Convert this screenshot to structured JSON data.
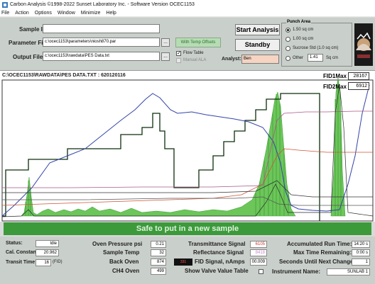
{
  "window": {
    "title": "Carbon Analysis ©1998-2022 Sunset Laboratory Inc. - Software Version OCEC1153"
  },
  "menu": [
    "File",
    "Action",
    "Options",
    "Window",
    "Minimize",
    "Help"
  ],
  "controls": {
    "sample_id_label": "Sample ID",
    "sample_id_value": "",
    "parameter_file_label": "Parameter File",
    "parameter_file_value": "c:\\ocec1153\\parameters\\niosh870.par",
    "output_file_label": "Output File",
    "output_file_value": "c:\\ocec1153\\rawdata\\PES Data.txt",
    "browse_label": "...",
    "with_temp_offsets_label": "With Temp Offsets",
    "flow_table_label": "Flow Table",
    "flow_table_checked": true,
    "manual_ala_label": "Manual ALA",
    "start_analysis_label": "Start Analysis",
    "standby_label": "Standby",
    "analyst_label": "Analyst:",
    "analyst_value": "Ben"
  },
  "punch_area": {
    "title": "Punch Area",
    "options": [
      "1.50 sq cm",
      "1.00 sq cm",
      "Sucrose Std (1.0 sq cm)",
      "Other"
    ],
    "selected_index": 0,
    "other_value": "1.41",
    "other_unit": "Sq cm"
  },
  "chart": {
    "path_label": "C:\\OCEC1153\\RAWDATA\\PES DATA.TXT : 620120116",
    "fid1max_label": "FID1Max",
    "fid1max_value": "28167",
    "fid2max_label": "FID2Max",
    "fid2max_value": "6912",
    "colors": {
      "temperature": "#0c2e0c",
      "fid": "#5fbf4a",
      "laser": "#3344aa",
      "pressure": "#cc5533",
      "oven_temp": "#aa5588"
    }
  },
  "status_message": "Safe to put in a new sample",
  "bottom": {
    "status_label": "Status:",
    "status_value": "Idle",
    "cal_constant_label": "Cal. Constant =",
    "cal_constant_value": "20.962",
    "transit_time_label": "Transit Time =",
    "transit_time_value": "16",
    "transit_time_unit": "(FID)",
    "oven_pressure_label": "Oven Pressure psi",
    "oven_pressure_value": "0.21",
    "sample_temp_label": "Sample Temp",
    "sample_temp_value": "32",
    "back_oven_label": "Back Oven",
    "back_oven_value": "874",
    "ch4_oven_label": "CH4 Oven",
    "ch4_oven_value": "499",
    "transmittance_label": "Transmittance Signal",
    "transmittance_value": "6105",
    "reflectance_label": "Reflectance Signal",
    "reflectance_value": "8418",
    "fid_signal_label": "FID Signal, nAmps",
    "fid_signal_value": "00.009",
    "fid_small_value": "331",
    "show_valve_label": "Show Valve Value Table",
    "accumulated_label": "Accumulated Run Time:",
    "accumulated_value": "14:20 s",
    "max_time_label": "Max Time Remaining:",
    "max_time_value": "0:00 s",
    "seconds_label": "Seconds Until Next Change:",
    "seconds_value": "1",
    "instrument_label": "Instrument Name:",
    "instrument_value": "SUNLAB 1"
  }
}
